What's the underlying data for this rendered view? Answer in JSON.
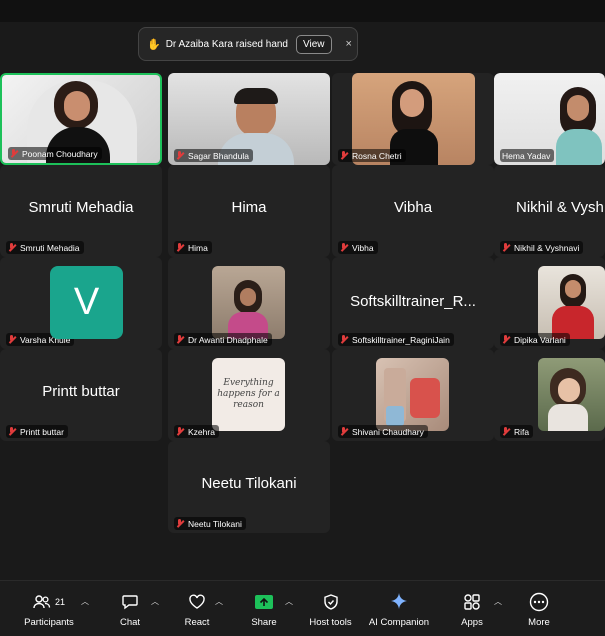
{
  "notification": {
    "text": "Dr Azaiba Kara raised hand",
    "view_label": "View",
    "close_icon": "×",
    "hand_icon": "✋"
  },
  "participants": [
    {
      "name": "Poonam Choudhary"
    },
    {
      "name": "Sagar Bhandula"
    },
    {
      "name": "Rosna Chetri"
    },
    {
      "name": "Hema Yadav"
    },
    {
      "name": "Smruti Mehadia",
      "display": "Smruti Mehadia"
    },
    {
      "name": "Hima",
      "display": "Hima"
    },
    {
      "name": "Vibha",
      "display": "Vibha"
    },
    {
      "name": "Nikhil & Vyshnavi",
      "display": "Nikhil & Vysh"
    },
    {
      "name": "Varsha Khule",
      "initial": "V"
    },
    {
      "name": "Dr Awanti Dhadphale"
    },
    {
      "name": "Softskilltrainer_RaginiJain",
      "display": "Softskilltrainer_R..."
    },
    {
      "name": "Dipika Varlani"
    },
    {
      "name": "Printt buttar",
      "display": "Printt buttar"
    },
    {
      "name": "Kzehra",
      "image_text": "Everything happens for a reason"
    },
    {
      "name": "Shivani Chaudhary"
    },
    {
      "name": "Rifa"
    },
    {
      "name": "Neetu Tilokani",
      "display": "Neetu Tilokani"
    }
  ],
  "toolbar": {
    "participants": {
      "label": "Participants",
      "count": "21"
    },
    "chat": {
      "label": "Chat"
    },
    "react": {
      "label": "React"
    },
    "share": {
      "label": "Share"
    },
    "host_tools": {
      "label": "Host tools"
    },
    "ai_companion": {
      "label": "AI Companion"
    },
    "apps": {
      "label": "Apps"
    },
    "more": {
      "label": "More"
    }
  },
  "colors": {
    "accent_green": "#1dc15a",
    "avatar_teal": "#1aa58d",
    "mic_muted": "#e03c3c",
    "ai_star": "#7fb3ff"
  }
}
